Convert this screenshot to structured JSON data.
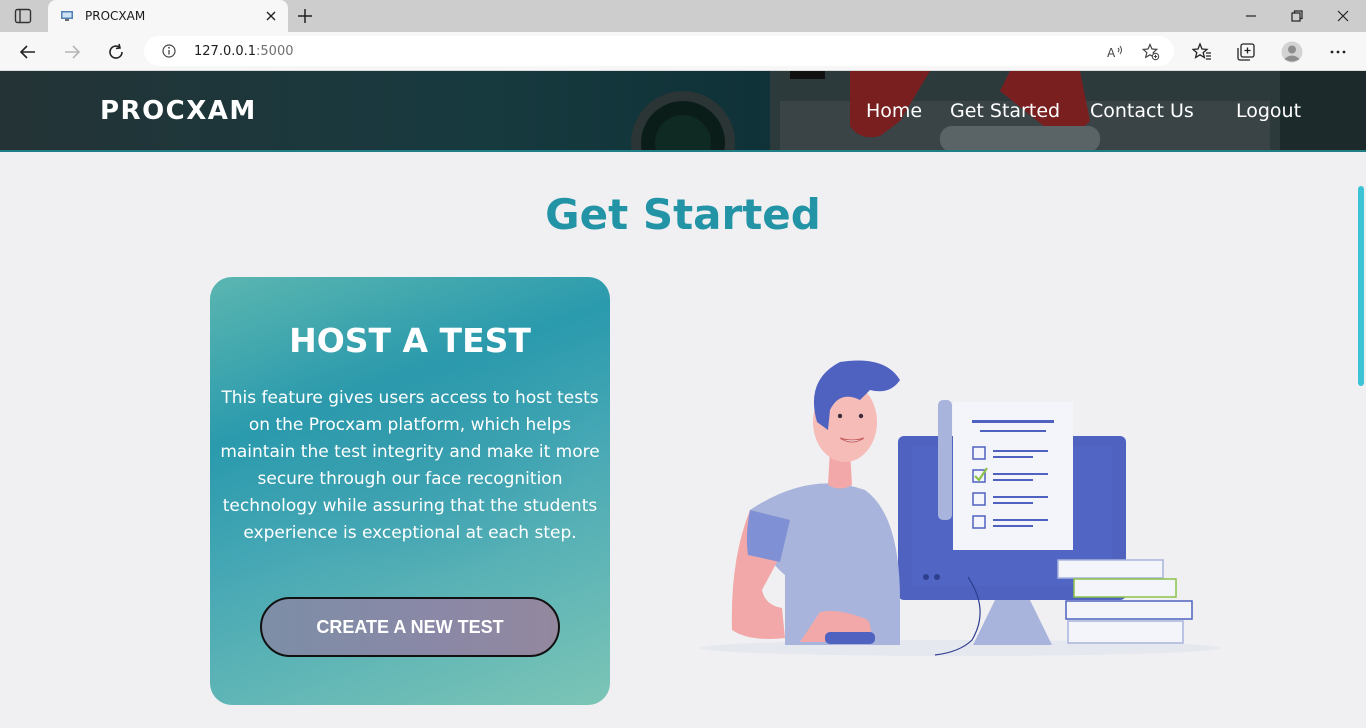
{
  "browser": {
    "tab_title": "PROCXAM",
    "address_host": "127.0.0.1",
    "address_port": ":5000"
  },
  "site": {
    "brand": "PROCXAM",
    "nav": [
      {
        "label": "Home"
      },
      {
        "label": "Get Started"
      },
      {
        "label": "Contact Us"
      },
      {
        "label": "Logout"
      }
    ]
  },
  "main": {
    "title": "Get Started",
    "card": {
      "title": "HOST A TEST",
      "description": "This feature gives users access to host tests on the Procxam platform, which helps maintain the test integrity and make it more secure through our face recognition technology while assuring that the students experience is exceptional at each step.",
      "button_label": "CREATE A NEW TEST"
    }
  },
  "colors": {
    "accent": "#2294a6",
    "header_bg": "#173a3f",
    "page_bg": "#f0f0f3"
  }
}
